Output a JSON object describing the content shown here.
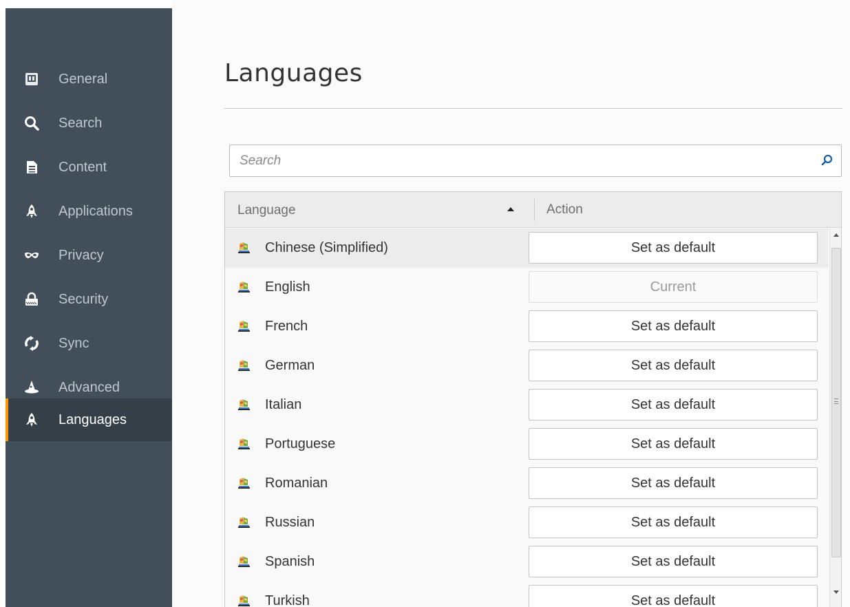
{
  "sidebar": {
    "items": [
      {
        "label": "General",
        "icon": "general-icon",
        "active": false
      },
      {
        "label": "Search",
        "icon": "search-icon",
        "active": false
      },
      {
        "label": "Content",
        "icon": "document-icon",
        "active": false
      },
      {
        "label": "Applications",
        "icon": "rocket-icon",
        "active": false
      },
      {
        "label": "Privacy",
        "icon": "mask-icon",
        "active": false
      },
      {
        "label": "Security",
        "icon": "lock-icon",
        "active": false
      },
      {
        "label": "Sync",
        "icon": "sync-icon",
        "active": false
      },
      {
        "label": "Advanced",
        "icon": "wizard-hat-icon",
        "active": false
      },
      {
        "label": "Languages",
        "icon": "rocket-icon",
        "active": true
      }
    ]
  },
  "main": {
    "title": "Languages",
    "search": {
      "placeholder": "Search",
      "value": ""
    },
    "table": {
      "columns": {
        "language": "Language",
        "action": "Action"
      },
      "sort": "ascending",
      "rows": [
        {
          "name": "Chinese (Simplified)",
          "action": "Set as default",
          "selected": true,
          "enabled": true
        },
        {
          "name": "English",
          "action": "Current",
          "selected": false,
          "enabled": false
        },
        {
          "name": "French",
          "action": "Set as default",
          "selected": false,
          "enabled": true
        },
        {
          "name": "German",
          "action": "Set as default",
          "selected": false,
          "enabled": true
        },
        {
          "name": "Italian",
          "action": "Set as default",
          "selected": false,
          "enabled": true
        },
        {
          "name": "Portuguese",
          "action": "Set as default",
          "selected": false,
          "enabled": true
        },
        {
          "name": "Romanian",
          "action": "Set as default",
          "selected": false,
          "enabled": true
        },
        {
          "name": "Russian",
          "action": "Set as default",
          "selected": false,
          "enabled": true
        },
        {
          "name": "Spanish",
          "action": "Set as default",
          "selected": false,
          "enabled": true
        },
        {
          "name": "Turkish",
          "action": "Set as default",
          "selected": false,
          "enabled": true
        }
      ]
    }
  },
  "colors": {
    "sidebar_bg": "#424f5a",
    "sidebar_active_bg": "#343f48",
    "accent": "#ff9500"
  }
}
